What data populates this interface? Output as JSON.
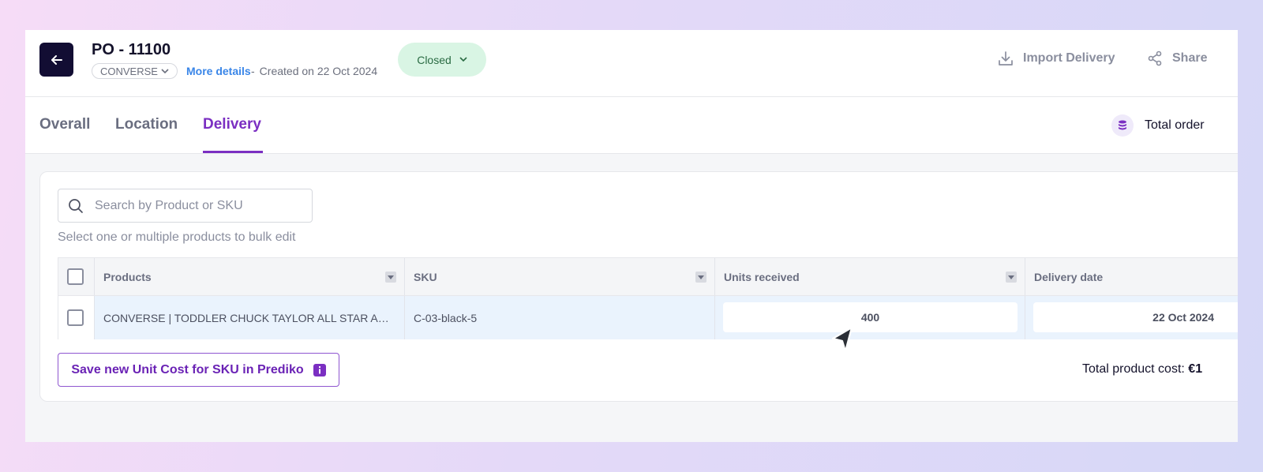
{
  "header": {
    "po_title": "PO - 11100",
    "supplier": "CONVERSE",
    "more_details": "More details",
    "separator": "-",
    "created_text": "Created on 22 Oct 2024",
    "status": "Closed",
    "actions": {
      "import_delivery": "Import Delivery",
      "share": "Share"
    }
  },
  "tabs": [
    {
      "label": "Overall",
      "active": false
    },
    {
      "label": "Location",
      "active": false
    },
    {
      "label": "Delivery",
      "active": true
    }
  ],
  "summary": {
    "total_order_label": "Total order"
  },
  "search": {
    "placeholder": "Search by Product or SKU",
    "value": ""
  },
  "bulk_hint": "Select one or multiple products to bulk edit",
  "table": {
    "columns": [
      "Products",
      "SKU",
      "Units received",
      "Delivery date"
    ],
    "rows": [
      {
        "product": "CONVERSE | TODDLER CHUCK TAYLOR ALL STAR AXEL ...",
        "sku": "C-03-black-5",
        "units_received": "400",
        "delivery_date": "22 Oct 2024"
      }
    ]
  },
  "footer": {
    "save_button": "Save new Unit Cost for SKU in Prediko",
    "total_cost_label": "Total product cost:",
    "total_cost_value": "€1"
  },
  "colors": {
    "accent": "#7b2fc2",
    "header_dark": "#120d33",
    "status_bg": "#d9f5e4",
    "status_text": "#2a6b43",
    "link": "#3a86e8",
    "row_selected_bg": "#eaf3fd"
  },
  "icons": {
    "back": "arrow-left-icon",
    "supplier_dropdown": "chevron-down-icon",
    "status_dropdown": "chevron-down-icon",
    "import": "download-icon",
    "share": "share-icon",
    "total_order": "database-icon",
    "search": "search-icon",
    "filter": "filter-caret-icon",
    "info": "info-icon",
    "cursor": "mouse-cursor-icon"
  }
}
